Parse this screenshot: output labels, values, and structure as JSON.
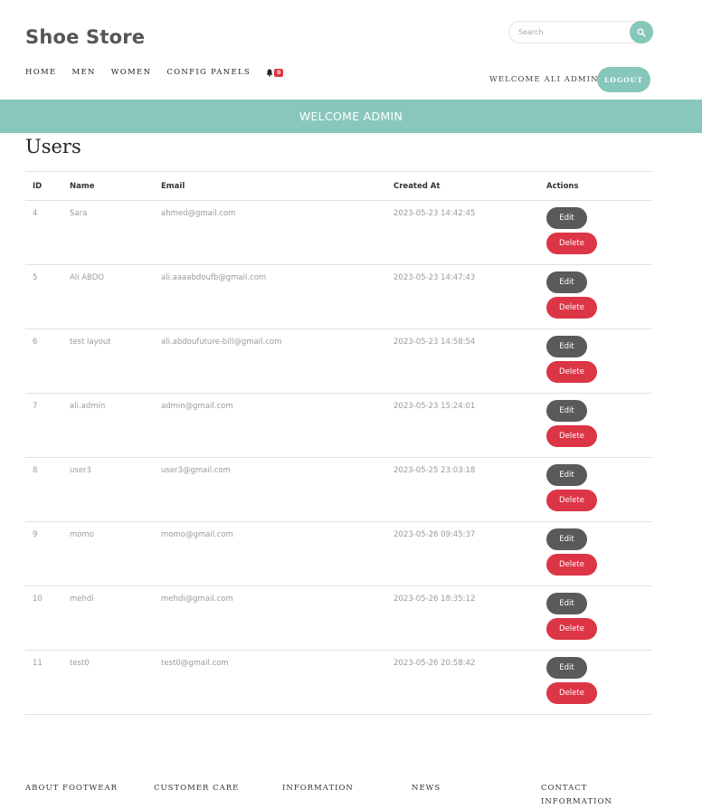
{
  "header": {
    "brand": "Shoe Store",
    "search": {
      "placeholder": "Search",
      "value": ""
    },
    "nav": [
      "HOME",
      "MEN",
      "WOMEN",
      "CONFIG PANELS"
    ],
    "notification_count": "0",
    "welcome": "WELCOME ALI ADMIN",
    "logout_label": "LOGOUT"
  },
  "banner": {
    "text": "WELCOME ADMIN"
  },
  "page": {
    "title": "Users"
  },
  "table": {
    "headers": [
      "ID",
      "Name",
      "Email",
      "Created At",
      "Actions"
    ],
    "rows": [
      {
        "id": "4",
        "name": "Sara",
        "email": "ahmed@gmail.com",
        "created": "2023-05-23 14:42:45",
        "edit": "Edit",
        "delete": "Delete"
      },
      {
        "id": "5",
        "name": "Ali ABDO",
        "email": "ali.aaaabdoufb@gmail.com",
        "created": "2023-05-23 14:47:43",
        "edit": "Edit",
        "delete": "Delete"
      },
      {
        "id": "6",
        "name": "test layout",
        "email": "ali.abdoufuture-bill@gmail.com",
        "created": "2023-05-23 14:58:54",
        "edit": "Edit",
        "delete": "Delete"
      },
      {
        "id": "7",
        "name": "ali.admin",
        "email": "admin@gmail.com",
        "created": "2023-05-23 15:24:01",
        "edit": "Edit",
        "delete": "Delete"
      },
      {
        "id": "8",
        "name": "user3",
        "email": "user3@gmail.com",
        "created": "2023-05-25 23:03:18",
        "edit": "Edit",
        "delete": "Delete"
      },
      {
        "id": "9",
        "name": "momo",
        "email": "momo@gmail.com",
        "created": "2023-05-26 09:45:37",
        "edit": "Edit",
        "delete": "Delete"
      },
      {
        "id": "10",
        "name": "mehdi",
        "email": "mehdi@gmail.com",
        "created": "2023-05-26 18:35:12",
        "edit": "Edit",
        "delete": "Delete"
      },
      {
        "id": "11",
        "name": "test0",
        "email": "test0@gmail.com",
        "created": "2023-05-26 20:58:42",
        "edit": "Edit",
        "delete": "Delete"
      }
    ]
  },
  "footer": {
    "columns": [
      "ABOUT FOOTWEAR",
      "CUSTOMER CARE",
      "INFORMATION",
      "NEWS",
      "CONTACT INFORMATION"
    ]
  },
  "colors": {
    "accent": "#89c7bc",
    "danger": "#dc3545",
    "edit": "#5a5a5a"
  },
  "icons": {
    "search": "search-icon",
    "notifications": "bell-icon"
  }
}
